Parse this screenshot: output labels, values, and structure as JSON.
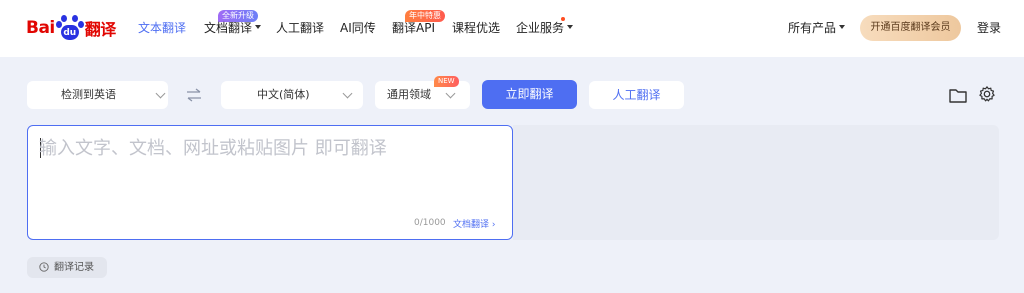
{
  "brand": {
    "logo_left": "Bai",
    "logo_paw": "du",
    "logo_right": "翻译"
  },
  "nav": {
    "items": [
      {
        "label": "文本翻译",
        "active": true
      },
      {
        "label": "文档翻译",
        "badge": "全新升级",
        "dropdown": true
      },
      {
        "label": "人工翻译"
      },
      {
        "label": "AI同传"
      },
      {
        "label": "翻译API",
        "badge": "年中特惠"
      },
      {
        "label": "课程优选"
      },
      {
        "label": "企业服务",
        "dropdown": true,
        "dot": true
      }
    ],
    "all_products": "所有产品",
    "vip": "开通百度翻译会员",
    "login": "登录"
  },
  "toolbar": {
    "source_lang": "检测到英语",
    "target_lang": "中文(简体)",
    "domain": "通用领域",
    "domain_tag": "NEW",
    "translate_button": "立即翻译",
    "human_button": "人工翻译",
    "icons": [
      "folder-icon",
      "gear-icon",
      "swap-icon"
    ]
  },
  "input": {
    "placeholder": "输入文字、文档、网址或粘贴图片 即可翻译",
    "value": "",
    "counter": "0/1000",
    "doc_link": "文档翻译 ›"
  },
  "history": {
    "label": "翻译记录"
  },
  "colors": {
    "accent": "#4e6ef2",
    "brand_red": "#e10602",
    "brand_blue": "#2932e1",
    "background": "#eef1f9"
  }
}
